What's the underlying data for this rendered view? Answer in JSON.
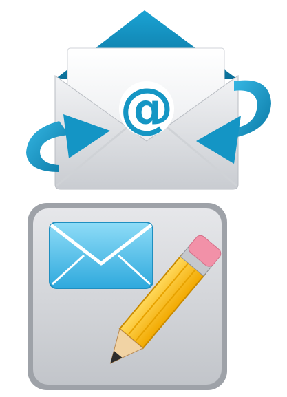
{
  "icons": [
    {
      "name": "email-at-icon",
      "symbol": "@",
      "colors": {
        "accent": "#1596c4",
        "envelope": "#e4e6e9",
        "letter": "#f6f7f8"
      }
    },
    {
      "name": "compose-mail-icon",
      "colors": {
        "tile": "#d6d8dc",
        "envelope": "#5cc6ef",
        "pencil": "#ffc21c",
        "eraser": "#f291a8"
      }
    }
  ]
}
